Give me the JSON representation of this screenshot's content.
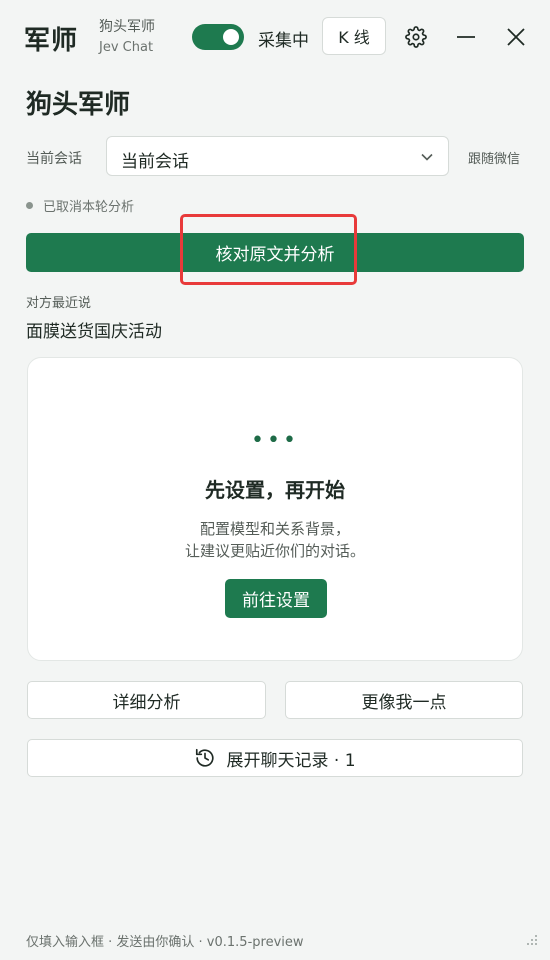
{
  "titlebar": {
    "logo": "军师",
    "app_name": "狗头军师",
    "app_sub": "Jev Chat",
    "collect_label": "采集中",
    "kline_label": "K 线",
    "icons": [
      "gear-icon",
      "minimize-icon",
      "close-icon"
    ]
  },
  "main": {
    "title": "狗头军师",
    "session_label": "当前会话",
    "session_value": "当前会话",
    "follow_link": "跟随微信",
    "status_text": "已取消本轮分析",
    "analyze_button": "核对原文并分析",
    "peer_label": "对方最近说",
    "peer_message": "面膜送货国庆活动"
  },
  "card": {
    "dots": "•••",
    "title": "先设置，再开始",
    "desc_line1": "配置模型和关系背景，",
    "desc_line2": "让建议更贴近你们的对话。",
    "button": "前往设置"
  },
  "actions": {
    "detail": "详细分析",
    "more_like_me": "更像我一点",
    "history": "展开聊天记录 · 1"
  },
  "footer": {
    "text": "仅填入输入框 · 发送由你确认 · v0.1.5-preview"
  },
  "colors": {
    "accent": "#1e7a4f",
    "highlight": "#e83a3a",
    "background": "#f3f5f4"
  }
}
